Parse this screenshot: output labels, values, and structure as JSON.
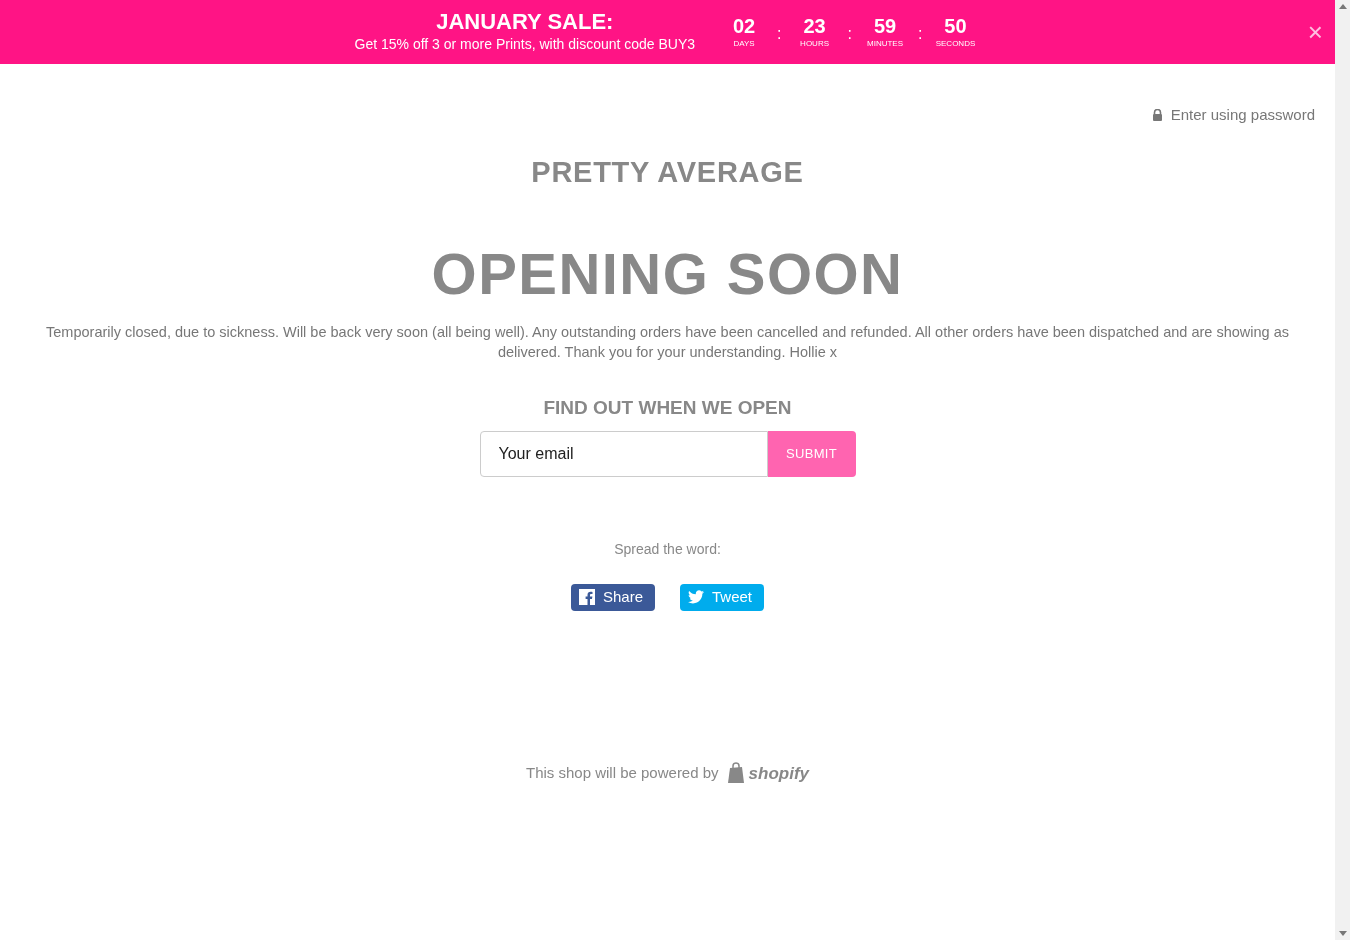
{
  "banner": {
    "title": "JANUARY SALE:",
    "subtitle": "Get 15% off 3 or more Prints, with discount code BUY3",
    "countdown": [
      {
        "value": "02",
        "unit": "DAYS"
      },
      {
        "value": "23",
        "unit": "HOURS"
      },
      {
        "value": "59",
        "unit": "MINUTES"
      },
      {
        "value": "50",
        "unit": "SECONDS"
      }
    ],
    "separator": ":",
    "close": "×"
  },
  "password_link": "Enter using password",
  "store_name": "PRETTY AVERAGE",
  "heading": "OPENING SOON",
  "message": "Temporarily closed, due to sickness. Will be back very soon (all being well). Any outstanding orders have been cancelled and refunded. All other orders have been dispatched and are showing as delivered. Thank you for your understanding. Hollie x",
  "signup": {
    "title": "FIND OUT WHEN WE OPEN",
    "placeholder": "Your email",
    "button": "SUBMIT"
  },
  "share": {
    "label": "Spread the word:",
    "buttons": [
      {
        "kind": "facebook",
        "label": "Share"
      },
      {
        "kind": "twitter",
        "label": "Tweet"
      }
    ]
  },
  "footer": {
    "text": "This shop will be powered by",
    "brand": "shopify"
  }
}
